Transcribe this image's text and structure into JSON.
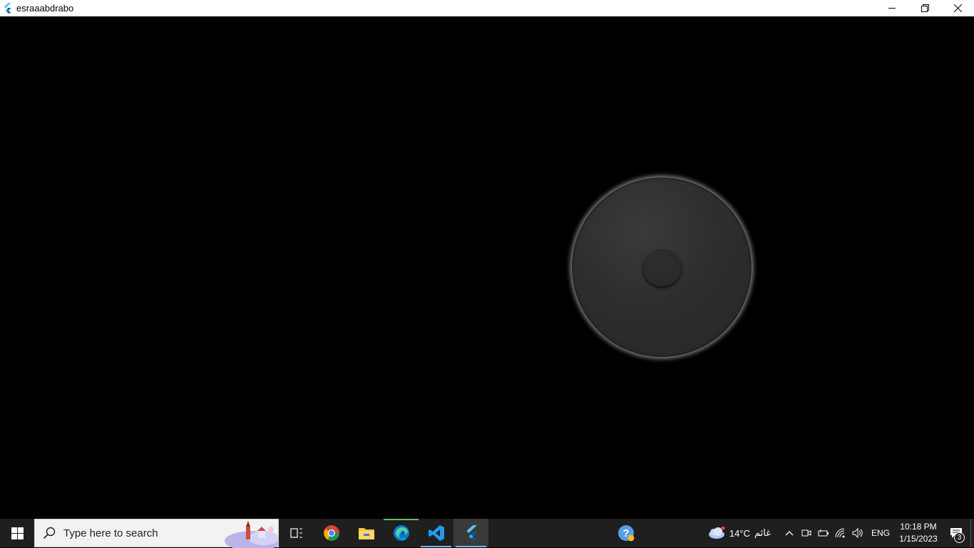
{
  "window": {
    "title": "esraaabdrabo",
    "controls": [
      "minimize",
      "restore",
      "close"
    ]
  },
  "taskbar": {
    "search_placeholder": "Type here to search",
    "pinned": [
      {
        "name": "task-view",
        "icon": "task-view-icon"
      },
      {
        "name": "chrome",
        "icon": "chrome-icon"
      },
      {
        "name": "file-explorer",
        "icon": "folder-icon"
      },
      {
        "name": "edge",
        "icon": "edge-icon"
      },
      {
        "name": "vscode",
        "icon": "vscode-icon"
      },
      {
        "name": "flutter",
        "icon": "flutter-icon"
      }
    ],
    "weather": {
      "temp": "14°C",
      "condition": "غائم"
    },
    "language": "ENG",
    "time": "10:18 PM",
    "date": "1/15/2023",
    "notification_count": "3"
  },
  "colors": {
    "background": "#000000",
    "taskbar": "#1f1f1f",
    "accent": "#76b9ed"
  }
}
